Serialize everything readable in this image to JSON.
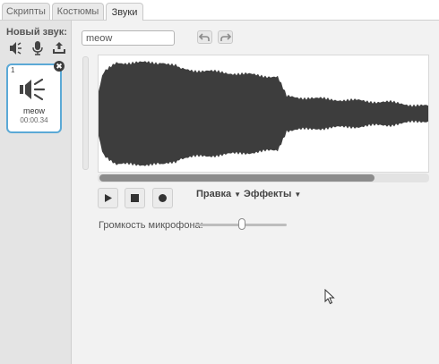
{
  "tabs": [
    {
      "label": "Скрипты",
      "active": false
    },
    {
      "label": "Костюмы",
      "active": false
    },
    {
      "label": "Звуки",
      "active": true
    }
  ],
  "sidebar": {
    "title": "Новый звук:",
    "new_sound_icons": [
      "speaker-library-icon",
      "microphone-icon",
      "upload-icon"
    ],
    "sounds": [
      {
        "number": "1",
        "name": "meow",
        "duration": "00:00.34",
        "selected": true
      }
    ]
  },
  "editor": {
    "sound_name": "meow",
    "menus": {
      "edit": "Правка",
      "effects": "Эффекты"
    },
    "microphone_label": "Громкость микрофона:",
    "microphone_volume": 0.5,
    "scroll_position": 0.84,
    "controls": [
      "play-icon",
      "stop-icon",
      "record-icon"
    ]
  },
  "colors": {
    "waveform": "#3d3d3d",
    "selection_border": "#5ba9d6",
    "accent_ui": "#f2f2f2"
  }
}
